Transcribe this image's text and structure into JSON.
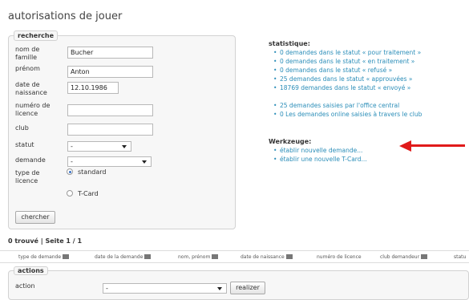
{
  "page_title": "autorisations de jouer",
  "search": {
    "legend": "recherche",
    "fields": {
      "nom_label": "nom de famille",
      "nom_value": "Bucher",
      "prenom_label": "prénom",
      "prenom_value": "Anton",
      "date_label": "date de naissance",
      "date_value": "12.10.1986",
      "licence_label": "numéro de licence",
      "licence_value": "",
      "club_label": "club",
      "club_value": "",
      "statut_label": "statut",
      "statut_value": "-",
      "demande_label": "demande",
      "demande_value": "-",
      "type_label": "type de licence",
      "type_option_standard": "standard",
      "type_option_tcard": "T-Card",
      "type_selected": "standard"
    },
    "button": "chercher"
  },
  "statistics": {
    "title": "statistique:",
    "items": [
      "0 demandes dans le statut « pour traitement »",
      "0 demandes dans le statut « en traitement »",
      "0 demandes dans le statut « refusé »",
      "25 demandes dans le statut « approuvées »",
      "18769 demandes dans le statut « envoyé »"
    ],
    "items2": [
      "25 demandes saisies par l'office central",
      "0 Les demandes online saisies à travers le club"
    ]
  },
  "tools": {
    "title": "Werkzeuge:",
    "items": [
      "établir nouvelle demande...",
      "établir une nouvelle T-Card..."
    ]
  },
  "results": {
    "info": "0 trouvé | Seite 1 / 1",
    "columns": [
      "type de demande",
      "date de la demande",
      "nom, prénom",
      "date de naissance",
      "numéro de licence",
      "club demandeur",
      "statu"
    ]
  },
  "actions": {
    "legend": "actions",
    "label": "action",
    "select_value": "-",
    "button": "realizer"
  },
  "colors": {
    "link": "#2a8db8",
    "arrow": "#e01a1a"
  }
}
